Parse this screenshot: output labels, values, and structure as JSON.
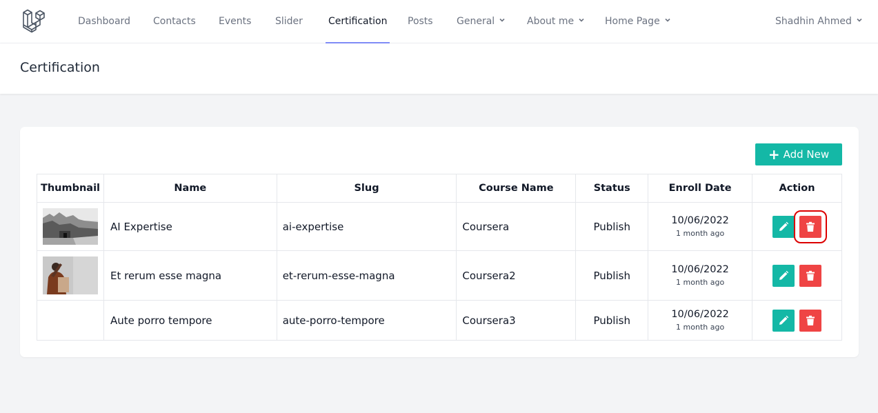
{
  "nav": {
    "links": [
      {
        "label": "Dashboard"
      },
      {
        "label": "Contacts"
      },
      {
        "label": "Events"
      },
      {
        "label": "Slider"
      },
      {
        "label": "Certification"
      },
      {
        "label": "Posts"
      },
      {
        "label": "General"
      },
      {
        "label": "About me"
      },
      {
        "label": "Home Page"
      }
    ],
    "user": "Shadhin Ahmed"
  },
  "header": {
    "title": "Certification"
  },
  "toolbar": {
    "add_label": "Add New",
    "add_icon": "plus-icon"
  },
  "table": {
    "columns": [
      "Thumbnail",
      "Name",
      "Slug",
      "Course Name",
      "Status",
      "Enroll Date",
      "Action"
    ],
    "rows": [
      {
        "name": "AI Expertise",
        "slug": "ai-expertise",
        "course": "Coursera",
        "status": "Publish",
        "date": "10/06/2022",
        "ago": "1 month ago",
        "thumbnail": "photo-coastal-village"
      },
      {
        "name": "Et rerum esse magna",
        "slug": "et-rerum-esse-magna",
        "course": "Coursera2",
        "status": "Publish",
        "date": "10/06/2022",
        "ago": "1 month ago",
        "thumbnail": "photo-woman-shopping"
      },
      {
        "name": "Aute porro tempore",
        "slug": "aute-porro-tempore",
        "course": "Coursera3",
        "status": "Publish",
        "date": "10/06/2022",
        "ago": "1 month ago",
        "thumbnail": ""
      }
    ]
  },
  "icons": {
    "edit": "pencil-icon",
    "delete": "trash-icon"
  },
  "colors": {
    "accent": "#14b8a6",
    "danger": "#ef4444",
    "active_underline": "#818cf8",
    "highlight": "#dc0000"
  }
}
